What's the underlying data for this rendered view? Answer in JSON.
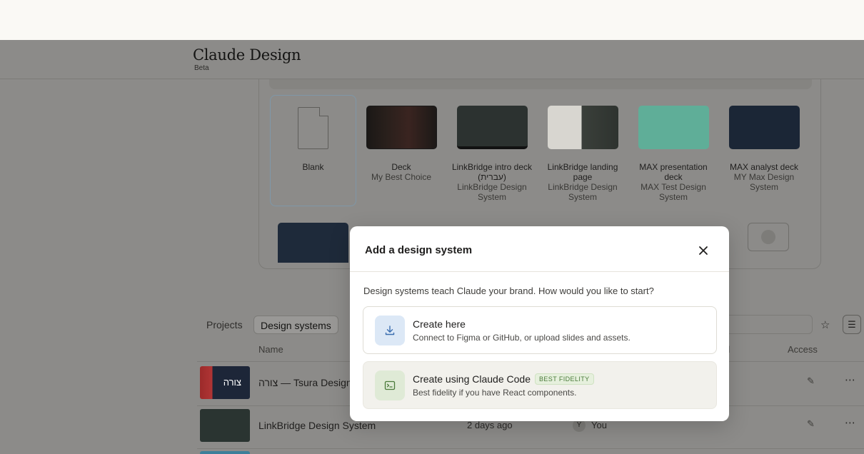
{
  "app": {
    "title": "Claude Design",
    "badge": "Beta"
  },
  "templates": {
    "blank": {
      "label": "Blank"
    },
    "items": [
      {
        "name": "Deck",
        "subtitle": "My Best Choice"
      },
      {
        "name": "LinkBridge intro deck (עברית)",
        "subtitle": "LinkBridge Design System"
      },
      {
        "name": "LinkBridge landing page",
        "subtitle": "LinkBridge Design System"
      },
      {
        "name": "MAX presentation deck",
        "subtitle": "MAX Test Design System"
      },
      {
        "name": "MAX analyst deck",
        "subtitle": "MY Max Design System"
      }
    ]
  },
  "tabs": {
    "projects": "Projects",
    "design_systems": "Design systems"
  },
  "table": {
    "columns": {
      "name": "Name",
      "access": "Access"
    },
    "rows": [
      {
        "name": "צורה — Tsura Design System",
        "date": "",
        "owner": ""
      },
      {
        "name": "LinkBridge Design System",
        "date": "2 days ago",
        "owner": "You",
        "avatar": "Y"
      }
    ]
  },
  "modal": {
    "title": "Add a design system",
    "description": "Design systems teach Claude your brand. How would you like to start?",
    "options": [
      {
        "title": "Create here",
        "subtitle": "Connect to Figma or GitHub, or upload slides and assets.",
        "icon": "download-icon"
      },
      {
        "title": "Create using Claude Code",
        "badge": "BEST FIDELITY",
        "subtitle": "Best fidelity if you have React components.",
        "icon": "terminal-icon"
      }
    ]
  },
  "colors": {
    "accent_blue": "#dce8f6",
    "accent_green": "#dfead6",
    "badge_green": "#4a7a3a"
  }
}
